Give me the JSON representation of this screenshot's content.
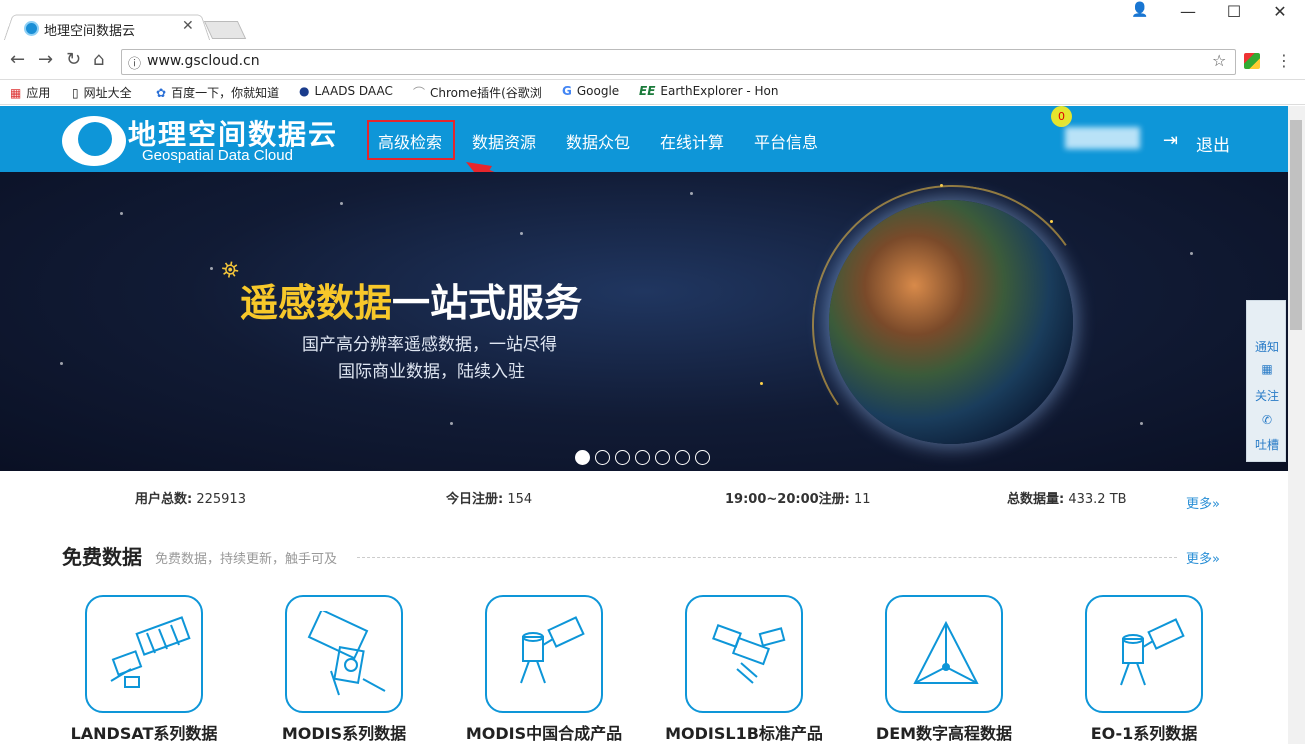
{
  "browser": {
    "tab_title": "地理空间数据云",
    "url": "www.gscloud.cn",
    "bookmarks": [
      "应用",
      "网址大全",
      "百度一下，你就知道",
      "LAADS DAAC",
      "Chrome插件(谷歌浏",
      "Google",
      "EarthExplorer - Hon"
    ]
  },
  "header": {
    "logo_cn": "地理空间数据云",
    "logo_en": "Geospatial Data Cloud",
    "nav": [
      "高级检索",
      "数据资源",
      "数据众包",
      "在线计算",
      "平台信息"
    ],
    "badge": "0",
    "logout": "退出"
  },
  "banner": {
    "headline_yellow": "遥感数据",
    "headline_white": "一站式服务",
    "sub1": "国产高分辨率遥感数据，一站尽得",
    "sub2": "国际商业数据，陆续入驻"
  },
  "side": {
    "notice": "通知",
    "follow": "关注",
    "complain": "吐槽"
  },
  "stats": {
    "users_label": "用户总数:",
    "users": "225913",
    "today_label": "今日注册:",
    "today": "154",
    "hour_label": "19:00~20:00注册:",
    "hour": "11",
    "data_label": "总数据量:",
    "data": "433.2 TB",
    "more": "更多»"
  },
  "section": {
    "title": "免费数据",
    "subtitle": "免费数据，持续更新，触手可及",
    "more": "更多»"
  },
  "products": [
    "LANDSAT系列数据",
    "MODIS系列数据",
    "MODIS中国合成产品",
    "MODISL1B标准产品",
    "DEM数字高程数据",
    "EO-1系列数据"
  ],
  "colors": {
    "brand": "#0e96d8",
    "highlight": "#e6262c",
    "headline_yellow": "#f7c82a"
  }
}
